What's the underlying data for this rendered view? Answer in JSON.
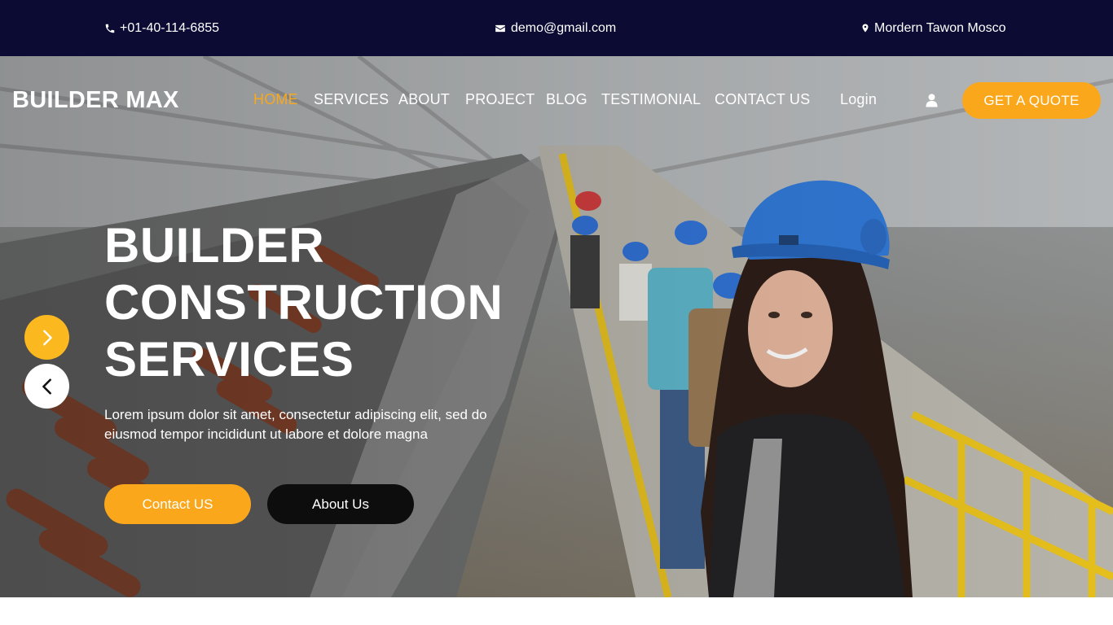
{
  "topbar": {
    "phone": "+01-40-114-6855",
    "email": "demo@gmail.com",
    "location": "Mordern Tawon Mosco"
  },
  "header": {
    "logo": "BUILDER MAX",
    "nav": [
      {
        "label": "HOME",
        "active": true
      },
      {
        "label": "SERVICES",
        "active": false
      },
      {
        "label": "ABOUT",
        "active": false
      },
      {
        "label": "PROJECT",
        "active": false
      },
      {
        "label": "BLOG",
        "active": false
      },
      {
        "label": "TESTIMONIAL",
        "active": false
      },
      {
        "label": "CONTACT US",
        "active": false
      }
    ],
    "login": "Login",
    "user_icon": "user-icon",
    "quote_button": "GET A QUOTE"
  },
  "hero": {
    "title_lines": [
      "BUILDER",
      "CONSTRUCTION",
      "SERVICES"
    ],
    "description": "Lorem ipsum dolor sit amet, consectetur adipiscing elit, sed do eiusmod tempor incididunt ut labore et dolore magna",
    "contact_button": "Contact US",
    "about_button": "About Us",
    "next_icon": "chevron-right-icon",
    "prev_icon": "chevron-left-icon"
  },
  "colors": {
    "topbar_bg": "#0b0b33",
    "accent": "#fba71b",
    "active_nav": "#f7a81f",
    "dark_button": "#0d0d0d",
    "white": "#ffffff"
  }
}
